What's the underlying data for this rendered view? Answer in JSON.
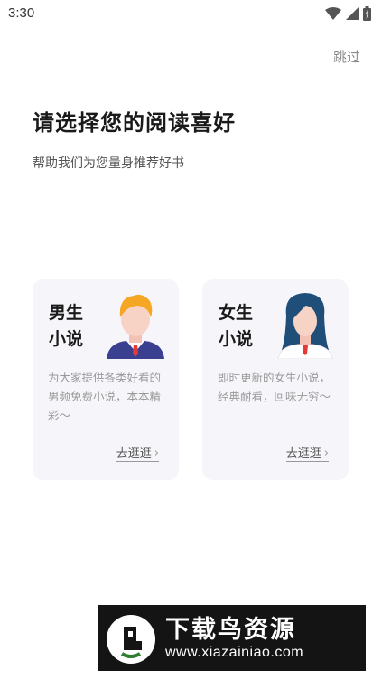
{
  "status_bar": {
    "time": "3:30"
  },
  "header": {
    "skip_label": "跳过"
  },
  "intro": {
    "title": "请选择您的阅读喜好",
    "subtitle": "帮助我们为您量身推荐好书"
  },
  "cards": [
    {
      "title": "男生小说",
      "title_line1": "男生",
      "title_line2": "小说",
      "description": "为大家提供各类好看的男频免费小说，本本精彩～",
      "link_label": "去逛逛",
      "avatar_icon": "male-avatar-icon",
      "hair_color": "#f5a623",
      "suit_color": "#3b3f8f"
    },
    {
      "title": "女生小说",
      "title_line1": "女生",
      "title_line2": "小说",
      "description": "即时更新的女生小说，经典耐看，回味无穷～",
      "link_label": "去逛逛",
      "avatar_icon": "female-avatar-icon",
      "hair_color": "#1f4e79",
      "suit_color": "#ffffff"
    }
  ],
  "watermark": {
    "title": "下载鸟资源",
    "url": "www.xiazainiao.com"
  },
  "colors": {
    "background": "#ffffff",
    "card_background": "#f5f5fa",
    "muted_text": "#9a9a9a",
    "accent_red": "#e53935"
  }
}
